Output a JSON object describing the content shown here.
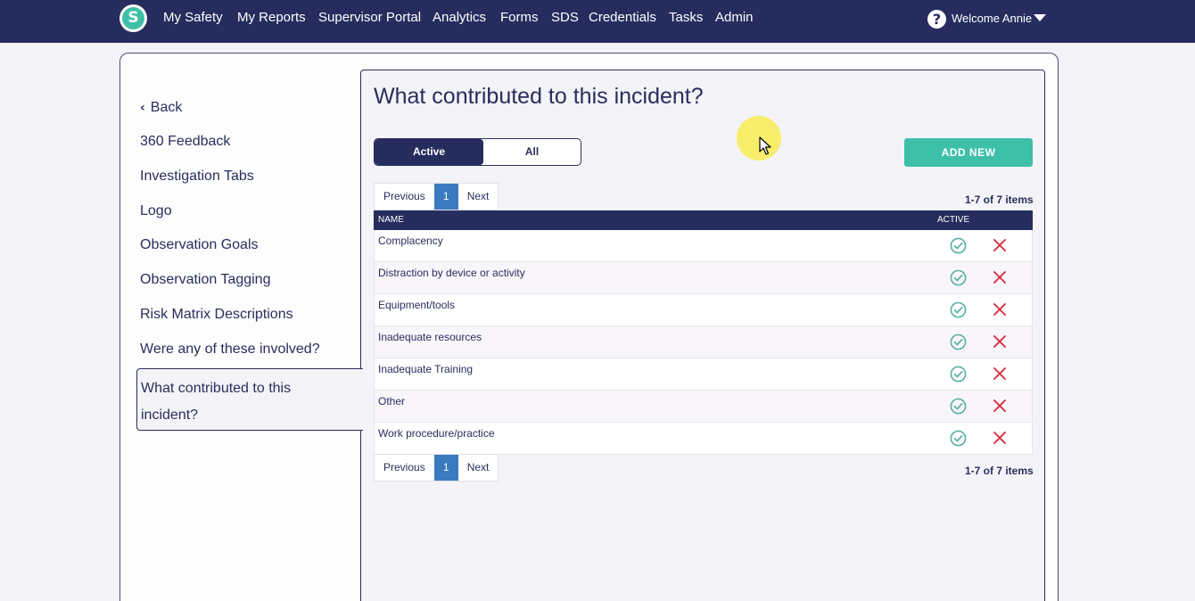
{
  "nav": {
    "logo_letter": "S",
    "links": [
      "My Safety",
      "My Reports",
      "Supervisor Portal",
      "Analytics",
      "Forms",
      "SDS",
      "Credentials",
      "Tasks",
      "Admin"
    ],
    "welcome": "Welcome Annie"
  },
  "sidebar": {
    "back_label": "Back",
    "items": [
      "360 Feedback",
      "Investigation Tabs",
      "Logo",
      "Observation Goals",
      "Observation Tagging",
      "Risk Matrix Descriptions",
      "Were any of these involved?"
    ],
    "active_item": "What contributed to this incident?"
  },
  "main": {
    "title": "What contributed to this incident?",
    "toggle": {
      "active_label": "Active",
      "all_label": "All"
    },
    "add_button": "ADD NEW",
    "pager": {
      "previous": "Previous",
      "page": "1",
      "next": "Next"
    },
    "item_count": "1-7 of 7 items",
    "table": {
      "headers": {
        "name": "NAME",
        "active": "ACTIVE"
      },
      "rows": [
        "Complacency",
        "Distraction by device or activity",
        "Equipment/tools",
        "Inadequate resources",
        "Inadequate Training",
        "Other",
        "Work procedure/practice"
      ]
    }
  },
  "colors": {
    "navbar": "#262d5e",
    "accent": "#3ebfa8",
    "pager_active": "#3a7bc0",
    "active_check": "#5fb3a5",
    "delete_x": "#d62b3a"
  },
  "icons": [
    "help-icon",
    "caret-down-icon",
    "chevron-left-icon",
    "check-circle-icon",
    "close-icon"
  ]
}
